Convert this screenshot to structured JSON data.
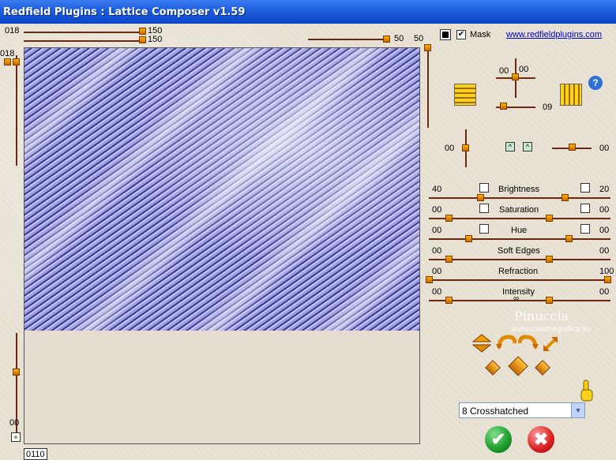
{
  "window": {
    "title": "Redfield Plugins : Lattice Composer v1.59"
  },
  "top": {
    "left_value": "018",
    "val_a": "150",
    "val_b": "150",
    "right_a": "50",
    "right_b": "50"
  },
  "left": {
    "top_value": "018",
    "bottom_value": "00"
  },
  "mask": {
    "label": "Mask",
    "checked": "✔"
  },
  "link": "www.redfieldplugins.com",
  "help": "?",
  "angle_panel": {
    "a": "00",
    "b": "00",
    "c": "09"
  },
  "shift_panel": {
    "left": "00",
    "right": "00"
  },
  "sliders": [
    {
      "name": "Brightness",
      "left": "40",
      "right": "20"
    },
    {
      "name": "Saturation",
      "left": "00",
      "right": "00"
    },
    {
      "name": "Hue",
      "left": "00",
      "right": "00"
    },
    {
      "name": "Soft Edges",
      "left": "00",
      "right": "00"
    },
    {
      "name": "Refraction",
      "left": "00",
      "right": "100"
    },
    {
      "name": "Intensity",
      "left": "00",
      "right": "00"
    }
  ],
  "watermark": {
    "name": "Pinuccia",
    "site": "www.maidiregrafica.eu"
  },
  "dropdown": {
    "selected": "8 Crosshatched"
  },
  "status": {
    "code": "0110"
  },
  "actions": {
    "ok": "✔",
    "cancel": "✖"
  }
}
